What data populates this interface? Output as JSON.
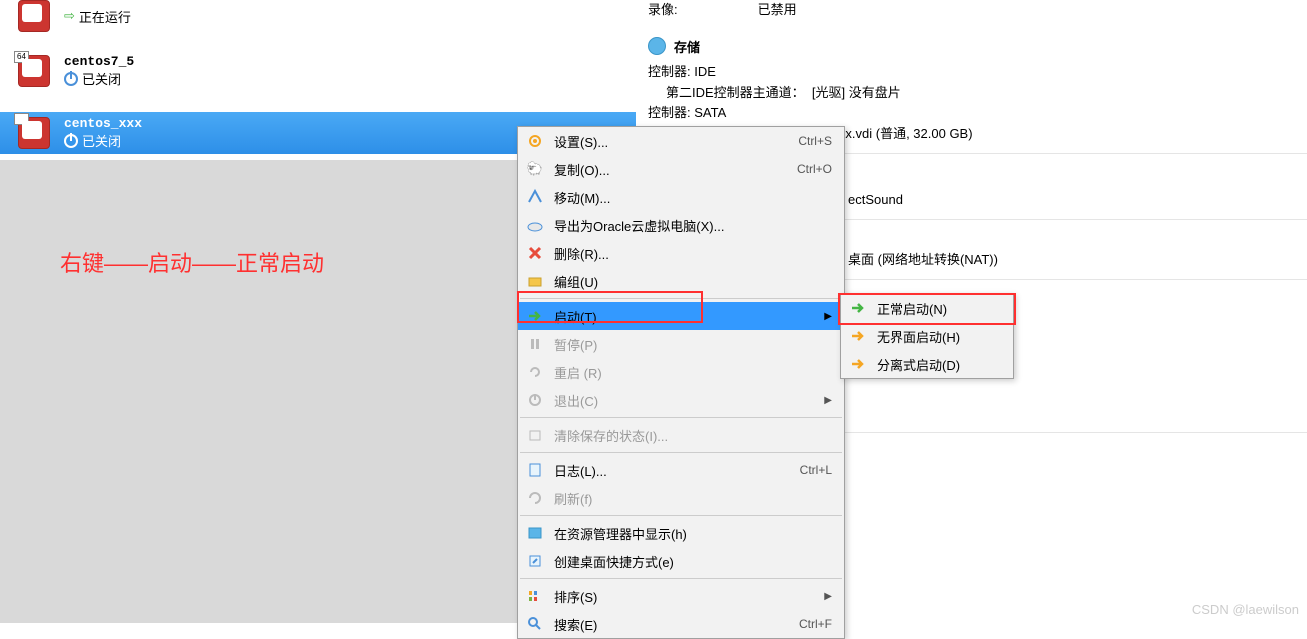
{
  "vms": [
    {
      "name": "",
      "status": "正在运行",
      "badge": "",
      "selected": false
    },
    {
      "name": "centos7_5",
      "status": "已关闭",
      "badge": "64",
      "selected": false
    },
    {
      "name": "centos_xxx",
      "status": "已关闭",
      "badge": "64",
      "selected": true
    }
  ],
  "annotation": "右键——启动——正常启动",
  "top_cut": {
    "label1": "录像:",
    "label2": "已禁用"
  },
  "storage": {
    "title": "存储",
    "ctrl1": "控制器: IDE",
    "ctrl1_line": "第二IDE控制器主通道：  [光驱] 没有盘片",
    "ctrl2": "控制器: SATA",
    "ctrl2_line": "SATA 端口 0：          centos_xxx.vdi (普通, 32.00 GB)"
  },
  "audio_fragment": "ectSound",
  "network_fragment": "桌面 (网络地址转换(NAT))",
  "menu": {
    "settings": {
      "label": "设置(S)...",
      "shortcut": "Ctrl+S"
    },
    "copy": {
      "label": "复制(O)...",
      "shortcut": "Ctrl+O"
    },
    "move": {
      "label": "移动(M)..."
    },
    "export": {
      "label": "导出为Oracle云虚拟电脑(X)..."
    },
    "delete": {
      "label": "删除(R)..."
    },
    "group": {
      "label": "编组(U)"
    },
    "start": {
      "label": "启动(T)"
    },
    "pause": {
      "label": "暂停(P)"
    },
    "reset": {
      "label": "重启 (R)"
    },
    "exit": {
      "label": "退出(C)"
    },
    "clear": {
      "label": "清除保存的状态(I)..."
    },
    "log": {
      "label": "日志(L)...",
      "shortcut": "Ctrl+L"
    },
    "refresh": {
      "label": "刷新(f)"
    },
    "explorer": {
      "label": "在资源管理器中显示(h)"
    },
    "shortcut": {
      "label": "创建桌面快捷方式(e)"
    },
    "sort": {
      "label": "排序(S)"
    },
    "search": {
      "label": "搜索(E)",
      "shortcut": "Ctrl+F"
    }
  },
  "submenu": {
    "normal": {
      "label": "正常启动(N)"
    },
    "headless": {
      "label": "无界面启动(H)"
    },
    "detach": {
      "label": "分离式启动(D)"
    }
  },
  "watermark": "CSDN @laewilson"
}
